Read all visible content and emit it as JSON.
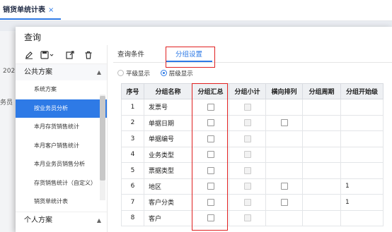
{
  "app": {
    "tab_label": "销货单统计表",
    "bg_text_year": "202",
    "bg_text_side": "务员"
  },
  "dialog": {
    "title": "查询"
  },
  "left_panel": {
    "icons": [
      "edit-icon",
      "save-icon",
      "export-icon",
      "delete-icon"
    ],
    "public_group": "公共方案",
    "public_items": [
      "系统方案",
      "按业务员分析",
      "本月存货销售统计",
      "本月客户销售统计",
      "本月业务员销售分析",
      "存货销售统计（自定义）",
      "销货单统计表"
    ],
    "active_index": 1,
    "personal_group": "个人方案"
  },
  "tabs": {
    "query": "查询条件",
    "group": "分组设置"
  },
  "display_mode": {
    "flat": "平级显示",
    "tiered": "层级显示",
    "selected": "tiered"
  },
  "grid": {
    "headers": [
      "序号",
      "分组名称",
      "分组汇总",
      "分组小计",
      "横向排列",
      "分组周期",
      "分组开始级"
    ],
    "rows": [
      {
        "no": "1",
        "name": "发票号",
        "summary": true,
        "subtotal": "disabled",
        "horizontal": "none",
        "period": "",
        "start": ""
      },
      {
        "no": "2",
        "name": "单据日期",
        "summary": true,
        "subtotal": "disabled",
        "horizontal": "box",
        "period": "",
        "start": ""
      },
      {
        "no": "3",
        "name": "单据编号",
        "summary": true,
        "subtotal": "disabled",
        "horizontal": "none",
        "period": "",
        "start": ""
      },
      {
        "no": "4",
        "name": "业务类型",
        "summary": true,
        "subtotal": "disabled",
        "horizontal": "none",
        "period": "",
        "start": ""
      },
      {
        "no": "5",
        "name": "票据类型",
        "summary": true,
        "subtotal": "disabled",
        "horizontal": "none",
        "period": "",
        "start": ""
      },
      {
        "no": "6",
        "name": "地区",
        "summary": true,
        "subtotal": "disabled",
        "horizontal": "box",
        "period": "",
        "start": "1"
      },
      {
        "no": "7",
        "name": "客户分类",
        "summary": true,
        "subtotal": "disabled",
        "horizontal": "box",
        "period": "",
        "start": "1"
      },
      {
        "no": "8",
        "name": "客户",
        "summary": true,
        "subtotal": "disabled",
        "horizontal": "none",
        "period": "",
        "start": ""
      }
    ]
  },
  "colors": {
    "accent": "#2e7ae6",
    "highlight": "#e02020"
  }
}
